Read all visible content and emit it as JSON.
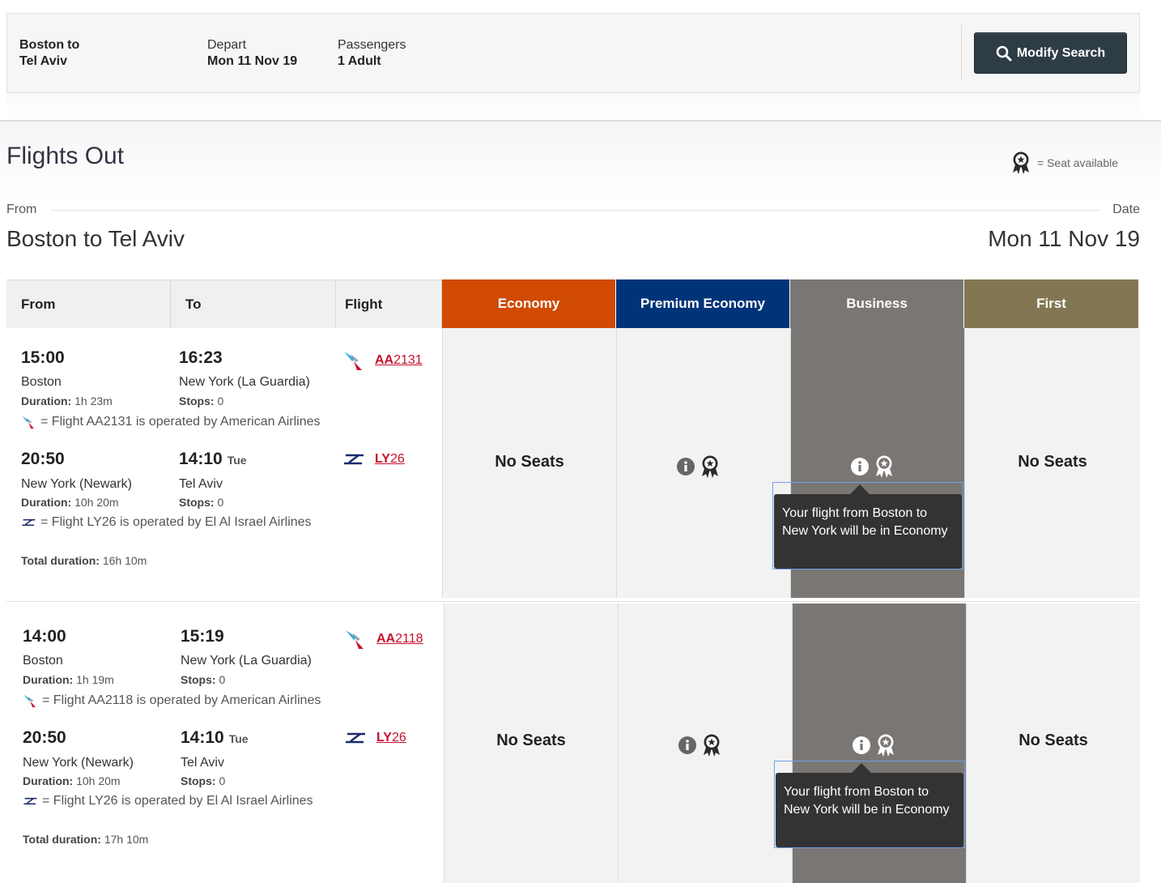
{
  "search": {
    "origin": "Boston",
    "to_word": "to",
    "destination": "Tel Aviv",
    "depart_label": "Depart",
    "depart_value": "Mon 11 Nov 19",
    "passengers_label": "Passengers",
    "passengers_value": "1 Adult",
    "modify_label": "Modify Search"
  },
  "heading": {
    "title": "Flights Out",
    "legend_text": "= Seat available",
    "from_label": "From",
    "date_label": "Date",
    "route": "Boston to Tel Aviv",
    "date": "Mon 11 Nov 19"
  },
  "table": {
    "headers": [
      "From",
      "To",
      "Flight"
    ],
    "cabins": [
      {
        "label": "Economy",
        "color": "#d04a02"
      },
      {
        "label": "Premium Economy",
        "color": "#003478"
      },
      {
        "label": "Business",
        "color": "#7a7674"
      },
      {
        "label": "First",
        "color": "#827653"
      }
    ]
  },
  "options": [
    {
      "segments": [
        {
          "dep_time": "15:00",
          "arr_time": "16:23",
          "arr_day": "",
          "dep_place": "Boston",
          "arr_place": "New York (La Guardia)",
          "duration_label": "Duration:",
          "duration": "1h 23m",
          "stops_label": "Stops:",
          "stops": "0",
          "flight_prefix": "AA",
          "flight_number": "2131",
          "airline_icon": "american-airlines-icon",
          "operated": "= Flight AA2131 is operated by American Airlines"
        },
        {
          "dep_time": "20:50",
          "arr_time": "14:10",
          "arr_day": "Tue",
          "dep_place": "New York (Newark)",
          "arr_place": "Tel Aviv",
          "duration_label": "Duration:",
          "duration": "10h 20m",
          "stops_label": "Stops:",
          "stops": "0",
          "flight_prefix": "LY",
          "flight_number": "26",
          "airline_icon": "el-al-icon",
          "operated": "= Flight LY26 is operated by El Al Israel Airlines"
        }
      ],
      "total_label": "Total duration:",
      "total": "16h 10m",
      "economy": "No Seats",
      "first": "No Seats",
      "tooltip": "Your flight from Boston to New York will be in Economy"
    },
    {
      "segments": [
        {
          "dep_time": "14:00",
          "arr_time": "15:19",
          "arr_day": "",
          "dep_place": "Boston",
          "arr_place": "New York (La Guardia)",
          "duration_label": "Duration:",
          "duration": "1h 19m",
          "stops_label": "Stops:",
          "stops": "0",
          "flight_prefix": "AA",
          "flight_number": "2118",
          "airline_icon": "american-airlines-icon",
          "operated": "= Flight AA2118 is operated by American Airlines"
        },
        {
          "dep_time": "20:50",
          "arr_time": "14:10",
          "arr_day": "Tue",
          "dep_place": "New York (Newark)",
          "arr_place": "Tel Aviv",
          "duration_label": "Duration:",
          "duration": "10h 20m",
          "stops_label": "Stops:",
          "stops": "0",
          "flight_prefix": "LY",
          "flight_number": "26",
          "airline_icon": "el-al-icon",
          "operated": "= Flight LY26 is operated by El Al Israel Airlines"
        }
      ],
      "total_label": "Total duration:",
      "total": "17h 10m",
      "economy": "No Seats",
      "first": "No Seats",
      "tooltip": "Your flight from Boston to New York will be in Economy"
    }
  ]
}
